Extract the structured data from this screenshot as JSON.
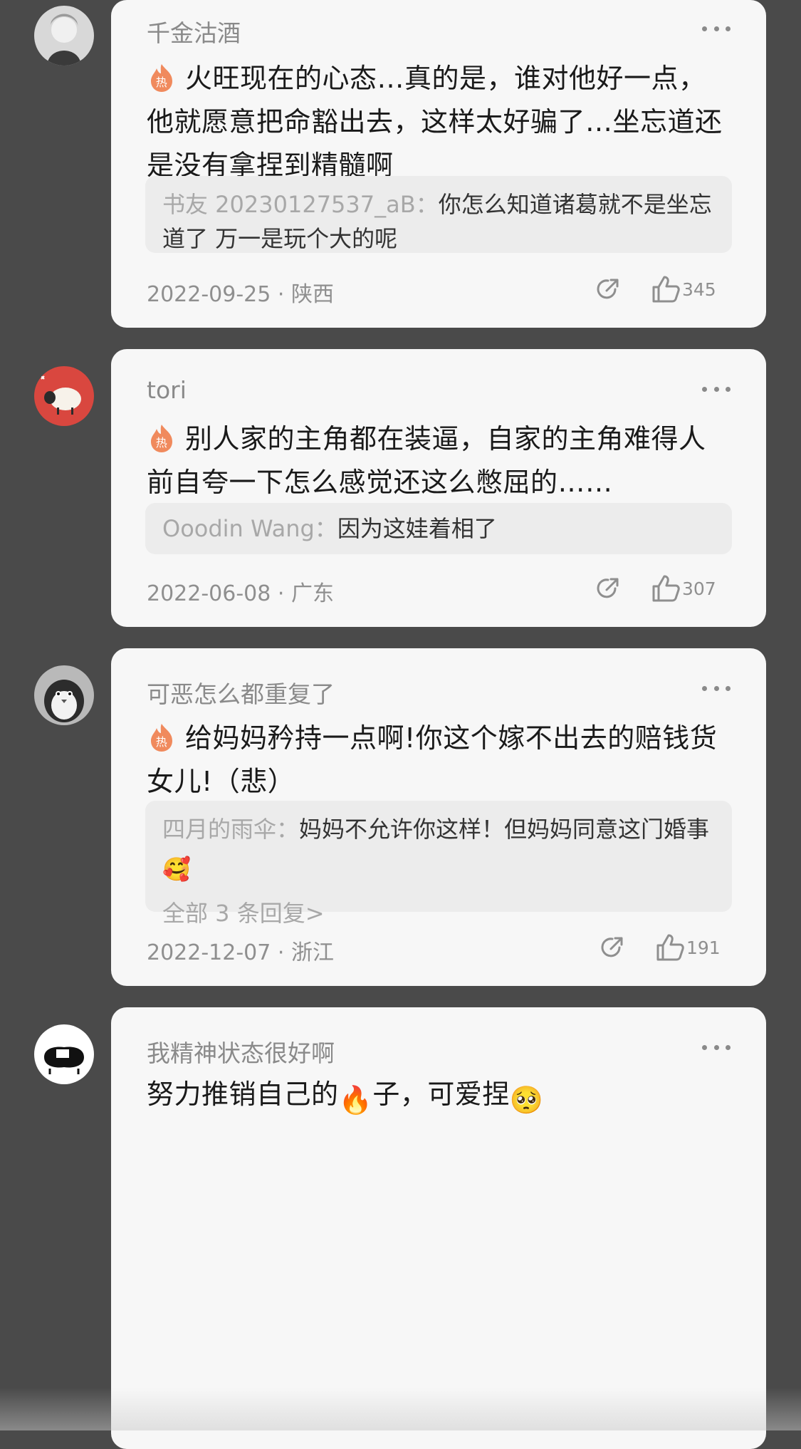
{
  "comments": [
    {
      "username": "千金沽酒",
      "text": "火旺现在的心态…真的是，谁对他好一点，他就愿意把命豁出去，这样太好骗了…坐忘道还是没有拿捏到精髓啊",
      "hot": true,
      "reply": {
        "author": "书友 20230127537_aB：",
        "text": "你怎么知道诸葛就不是坐忘道了 万一是玩个大的呢"
      },
      "date_location": "2022-09-25 · 陕西",
      "likes": "345"
    },
    {
      "username": "tori",
      "text": "别人家的主角都在装逼，自家的主角难得人前自夸一下怎么感觉还这么憋屈的……",
      "hot": true,
      "reply": {
        "author": "Ooodin Wang：",
        "text": "因为这娃着相了"
      },
      "date_location": "2022-06-08 · 广东",
      "likes": "307"
    },
    {
      "username": "可恶怎么都重复了",
      "text": "给妈妈矜持一点啊!你这个嫁不出去的赔钱货女儿!（悲）",
      "hot": true,
      "reply": {
        "author": "四月的雨伞：",
        "text": "妈妈不允许你这样！但妈妈同意这门婚事",
        "emoji": "🥰",
        "all_replies": "全部 3 条回复>"
      },
      "date_location": "2022-12-07 · 浙江",
      "likes": "191"
    },
    {
      "username": "我精神状态很好啊",
      "text_before": "努力推销自己的",
      "fire_emoji": "🔥",
      "text_after": "子，可爱捏",
      "end_emoji": "🥺"
    }
  ],
  "icons": {
    "hot": "hot-flame-badge-icon",
    "more": "more-dots-icon",
    "share": "share-icon",
    "like": "thumbs-up-icon"
  },
  "colors": {
    "background": "#4a4a4a",
    "card": "#f7f7f7",
    "hot_badge": "#f08a5d"
  }
}
